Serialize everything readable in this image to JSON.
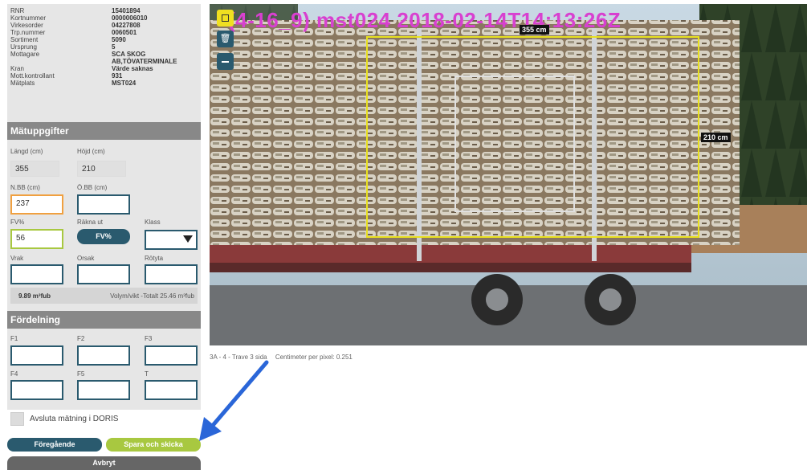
{
  "info": [
    {
      "label": "RNR",
      "value": "15401894"
    },
    {
      "label": "Kortnummer",
      "value": "0000006010"
    },
    {
      "label": "Virkesorder",
      "value": "04227808"
    },
    {
      "label": "Trp.nummer",
      "value": "0060501"
    },
    {
      "label": "Sortiment",
      "value": "5090"
    },
    {
      "label": "Ursprung",
      "value": "5"
    },
    {
      "label": "Mottagare",
      "value": "SCA SKOG"
    },
    {
      "label": "",
      "value": "AB,TÖVATERMINALE"
    },
    {
      "label": "Kran",
      "value": "Värde saknas"
    },
    {
      "label": "Mott.kontrollant",
      "value": "931"
    },
    {
      "label": "Mätplats",
      "value": "MST024"
    }
  ],
  "matuppgifter": {
    "title": "Mätuppgifter",
    "langd_label": "Längd (cm)",
    "langd_value": "355",
    "hojd_label": "Höjd (cm)",
    "hojd_value": "210",
    "nbb_label": "N.BB (cm)",
    "nbb_value": "237",
    "obb_label": "Ö.BB (cm)",
    "obb_value": "",
    "fv_label": "FV%",
    "fv_value": "56",
    "rakna_label": "Räkna ut",
    "rakna_button": "FV%",
    "klass_label": "Klass",
    "klass_value": "",
    "vrak_label": "Vrak",
    "orsak_label": "Orsak",
    "rotyta_label": "Rötyta",
    "volume_left": "9.89 m³fub",
    "volume_right": "Volym/vikt -Totalt 25.46 m³fub"
  },
  "fordelning": {
    "title": "Fördelning",
    "f1": "F1",
    "f2": "F2",
    "f3": "F3",
    "f4": "F4",
    "f5": "F5",
    "t": "T"
  },
  "doris": {
    "label": "Avsluta mätning i DORIS"
  },
  "buttons": {
    "prev": "Föregående",
    "save": "Spara och skicka",
    "cancel": "Avbryt"
  },
  "image": {
    "overlay_title": "(4-16_9) mst024 2018-02-14T14:13:26Z",
    "width_label": "355 cm",
    "height_label": "210 cm",
    "caption_left": "3A - 4 - Trave 3 sida",
    "caption_right": "Centimeter per pixel: 0.251"
  },
  "icons": {
    "tool1": "select-square-icon",
    "tool2": "trash-icon",
    "tool3": "minus-icon",
    "arrow": "blue-arrow-annotation"
  },
  "colors": {
    "accent": "#2a5a6e",
    "save": "#a8c840",
    "overlay": "#d840d0",
    "highlight": "#f0e020",
    "orange": "#f0a040"
  }
}
